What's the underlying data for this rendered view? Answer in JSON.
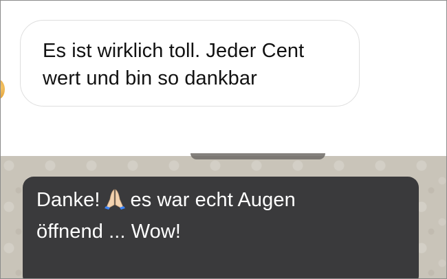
{
  "chat": {
    "incoming_message": {
      "line1": "Es ist wirklich toll. Jeder Cent",
      "line2": "wert und bin so dankbar"
    },
    "outgoing_message": {
      "line1_before_emoji": "Danke!",
      "emoji": "folded-hands-icon",
      "line1_after_emoji": "es war echt Augen",
      "line2": "öffnend ... Wow!"
    }
  },
  "colors": {
    "incoming_bubble": "#ffffff",
    "outgoing_bubble": "#3a3a3c",
    "chat_wallpaper": "#c9c4b9"
  }
}
